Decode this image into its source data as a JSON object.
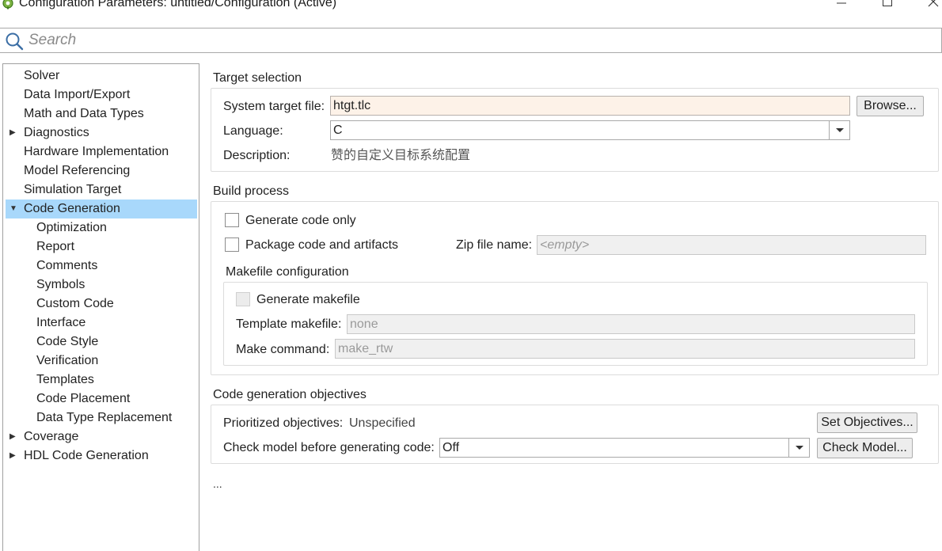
{
  "window": {
    "title": "Configuration Parameters: untitled/Configuration (Active)",
    "icon": "simulink-gear-icon",
    "controls": {
      "minimize": "minimize-icon",
      "maximize": "maximize-icon",
      "close": "close-icon"
    }
  },
  "search": {
    "placeholder": "Search",
    "value": ""
  },
  "tree": {
    "items": [
      {
        "label": "Solver",
        "level": 0,
        "expandable": false
      },
      {
        "label": "Data Import/Export",
        "level": 0,
        "expandable": false
      },
      {
        "label": "Math and Data Types",
        "level": 0,
        "expandable": false
      },
      {
        "label": "Diagnostics",
        "level": 0,
        "expandable": true,
        "expanded": false
      },
      {
        "label": "Hardware Implementation",
        "level": 0,
        "expandable": false
      },
      {
        "label": "Model Referencing",
        "level": 0,
        "expandable": false
      },
      {
        "label": "Simulation Target",
        "level": 0,
        "expandable": false
      },
      {
        "label": "Code Generation",
        "level": 0,
        "expandable": true,
        "expanded": true,
        "selected": true
      },
      {
        "label": "Optimization",
        "level": 1
      },
      {
        "label": "Report",
        "level": 1
      },
      {
        "label": "Comments",
        "level": 1
      },
      {
        "label": "Symbols",
        "level": 1
      },
      {
        "label": "Custom Code",
        "level": 1
      },
      {
        "label": "Interface",
        "level": 1
      },
      {
        "label": "Code Style",
        "level": 1
      },
      {
        "label": "Verification",
        "level": 1
      },
      {
        "label": "Templates",
        "level": 1
      },
      {
        "label": "Code Placement",
        "level": 1
      },
      {
        "label": "Data Type Replacement",
        "level": 1
      },
      {
        "label": "Coverage",
        "level": 0,
        "expandable": true,
        "expanded": false
      },
      {
        "label": "HDL Code Generation",
        "level": 0,
        "expandable": true,
        "expanded": false
      }
    ],
    "selected_color": "#a8d8fb"
  },
  "target_selection": {
    "title": "Target selection",
    "system_target_file_label": "System target file:",
    "system_target_file_value": "htgt.tlc",
    "browse_label": "Browse...",
    "language_label": "Language:",
    "language_value": "C",
    "description_label": "Description:",
    "description_value": "赞的自定义目标系统配置"
  },
  "build_process": {
    "title": "Build process",
    "generate_code_only_label": "Generate code only",
    "generate_code_only_checked": false,
    "package_code_label": "Package code and artifacts",
    "package_code_checked": false,
    "zip_file_label": "Zip file name:",
    "zip_file_placeholder": "<empty>",
    "makefile": {
      "title": "Makefile configuration",
      "generate_makefile_label": "Generate makefile",
      "generate_makefile_checked": false,
      "template_makefile_label": "Template makefile:",
      "template_makefile_value": "none",
      "make_command_label": "Make command:",
      "make_command_value": "make_rtw"
    }
  },
  "objectives": {
    "title": "Code generation objectives",
    "prioritized_label": "Prioritized objectives:",
    "prioritized_value": "Unspecified",
    "set_objectives_label": "Set Objectives...",
    "check_model_label": "Check model before generating code:",
    "check_model_value": "Off",
    "check_model_button_label": "Check Model..."
  },
  "footer": {
    "ellipsis": "..."
  }
}
